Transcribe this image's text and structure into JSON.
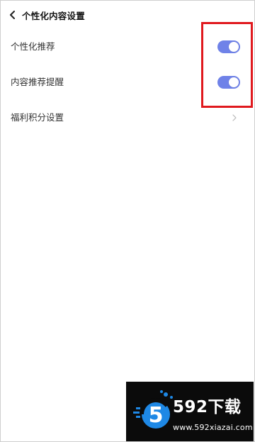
{
  "header": {
    "back_icon": "chevron-left-icon",
    "title": "个性化内容设置"
  },
  "settings": [
    {
      "label": "个性化推荐",
      "control": "toggle",
      "on": true
    },
    {
      "label": "内容推荐提醒",
      "control": "toggle",
      "on": true
    },
    {
      "label": "福利积分设置",
      "control": "chevron",
      "icon": "chevron-right-icon"
    }
  ],
  "colors": {
    "toggle_on": "#6f82e8",
    "highlight": "#e0191e",
    "watermark_bg": "#0b0b0b",
    "watermark_accent": "#1e88e5"
  },
  "watermark": {
    "brand": "592下载",
    "url": "www.592xiazai.com",
    "logo_glyph": "5"
  }
}
